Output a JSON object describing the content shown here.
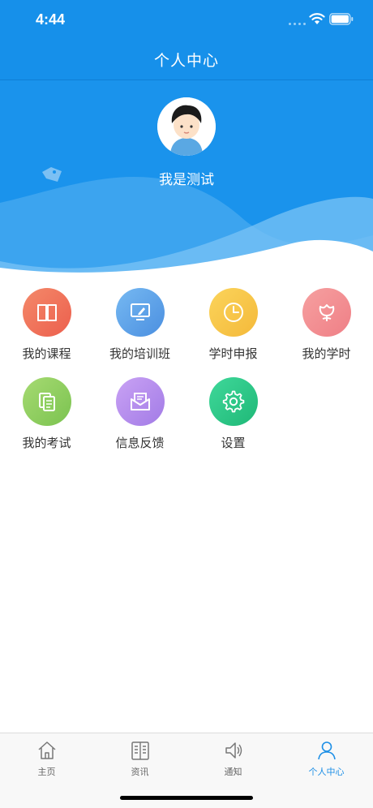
{
  "status_bar": {
    "time": "4:44"
  },
  "nav": {
    "title": "个人中心"
  },
  "profile": {
    "name": "我是测试"
  },
  "colors": {
    "brand": "#1690ea",
    "tab_active": "#1d8fe6",
    "courses": "#f0725a",
    "classes": "#5aa4e8",
    "hours_report": "#f7c745",
    "my_hours": "#f08c8c",
    "exams": "#92d061",
    "feedback": "#b48ded",
    "settings": "#2ec98a"
  },
  "grid": [
    {
      "label": "我的课程",
      "icon": "book-icon"
    },
    {
      "label": "我的培训班",
      "icon": "monitor-pen-icon"
    },
    {
      "label": "学时申报",
      "icon": "clock-icon"
    },
    {
      "label": "我的学时",
      "icon": "flower-icon"
    },
    {
      "label": "我的考试",
      "icon": "documents-icon"
    },
    {
      "label": "信息反馈",
      "icon": "envelope-icon"
    },
    {
      "label": "设置",
      "icon": "gear-icon"
    }
  ],
  "tabs": [
    {
      "label": "主页",
      "icon": "home-icon",
      "active": false
    },
    {
      "label": "资讯",
      "icon": "news-icon",
      "active": false
    },
    {
      "label": "通知",
      "icon": "speaker-icon",
      "active": false
    },
    {
      "label": "个人中心",
      "icon": "person-icon",
      "active": true
    }
  ]
}
